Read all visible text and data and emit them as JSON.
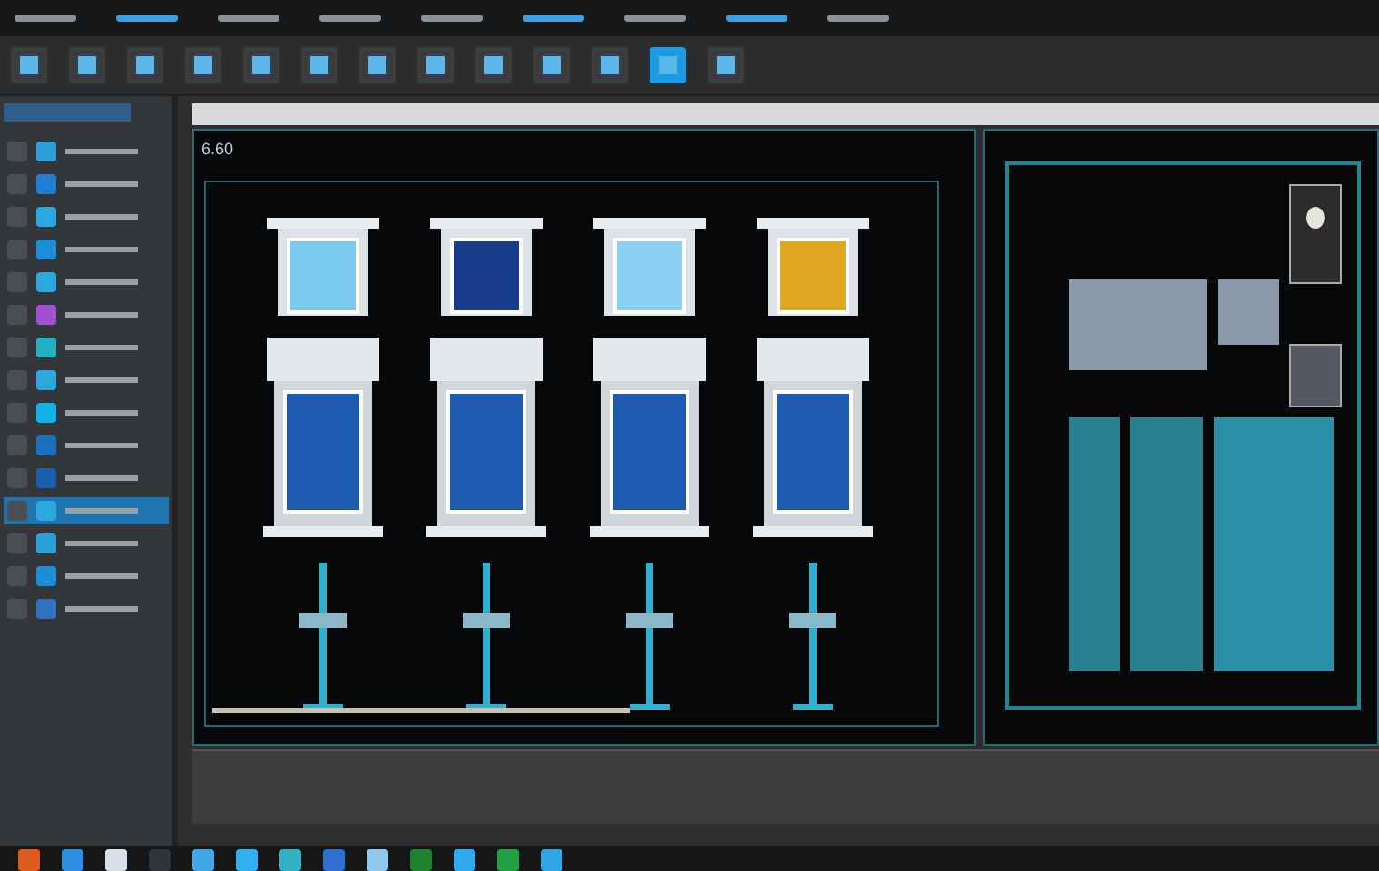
{
  "menu_bar": {
    "items": [
      {
        "selected": false
      },
      {
        "selected": true
      },
      {
        "selected": false
      },
      {
        "selected": false
      },
      {
        "selected": false
      },
      {
        "selected": true
      },
      {
        "selected": false
      },
      {
        "selected": true
      },
      {
        "selected": false
      }
    ]
  },
  "toolbar": {
    "tools": [
      {
        "selected": false
      },
      {
        "selected": false
      },
      {
        "selected": false
      },
      {
        "selected": false
      },
      {
        "selected": false
      },
      {
        "selected": false
      },
      {
        "selected": false
      },
      {
        "selected": false
      },
      {
        "selected": false
      },
      {
        "selected": false
      },
      {
        "selected": false
      },
      {
        "selected": true
      },
      {
        "selected": false
      }
    ]
  },
  "sidebar": {
    "items": [
      {
        "selected": false,
        "color": "#2a9fd8"
      },
      {
        "selected": false,
        "color": "#1e7fd0"
      },
      {
        "selected": false,
        "color": "#2aa8e0"
      },
      {
        "selected": false,
        "color": "#1a8fd8"
      },
      {
        "selected": false,
        "color": "#2aa8e0"
      },
      {
        "selected": false,
        "color": "#a050d0"
      },
      {
        "selected": false,
        "color": "#20b0c0"
      },
      {
        "selected": false,
        "color": "#2aa8e0"
      },
      {
        "selected": false,
        "color": "#10b0e8"
      },
      {
        "selected": false,
        "color": "#1a70c0"
      },
      {
        "selected": false,
        "color": "#1a60b0"
      },
      {
        "selected": true,
        "color": "#2aa8e0"
      },
      {
        "selected": false,
        "color": "#2a9fd8"
      },
      {
        "selected": false,
        "color": "#1a8fd8"
      },
      {
        "selected": false,
        "color": "#3070c0"
      }
    ]
  },
  "viewport": {
    "label": "6.60",
    "facades": [
      {
        "color": "#7cc8ee"
      },
      {
        "color": "#1a3a8a"
      },
      {
        "color": "#8ad0f0"
      },
      {
        "color": "#e0a820"
      }
    ]
  },
  "taskbar": {
    "apps": [
      {
        "color": "#e05a20"
      },
      {
        "color": "#2a8fe0"
      },
      {
        "color": "#d8e0e8"
      },
      {
        "color": "#303438"
      },
      {
        "color": "#40a8e8"
      },
      {
        "color": "#30b0f0"
      },
      {
        "color": "#30b0c0"
      },
      {
        "color": "#3070d0"
      },
      {
        "color": "#90c8f0"
      },
      {
        "color": "#208030"
      },
      {
        "color": "#30a8f0"
      },
      {
        "color": "#20a040"
      },
      {
        "color": "#30a8e8"
      }
    ]
  }
}
